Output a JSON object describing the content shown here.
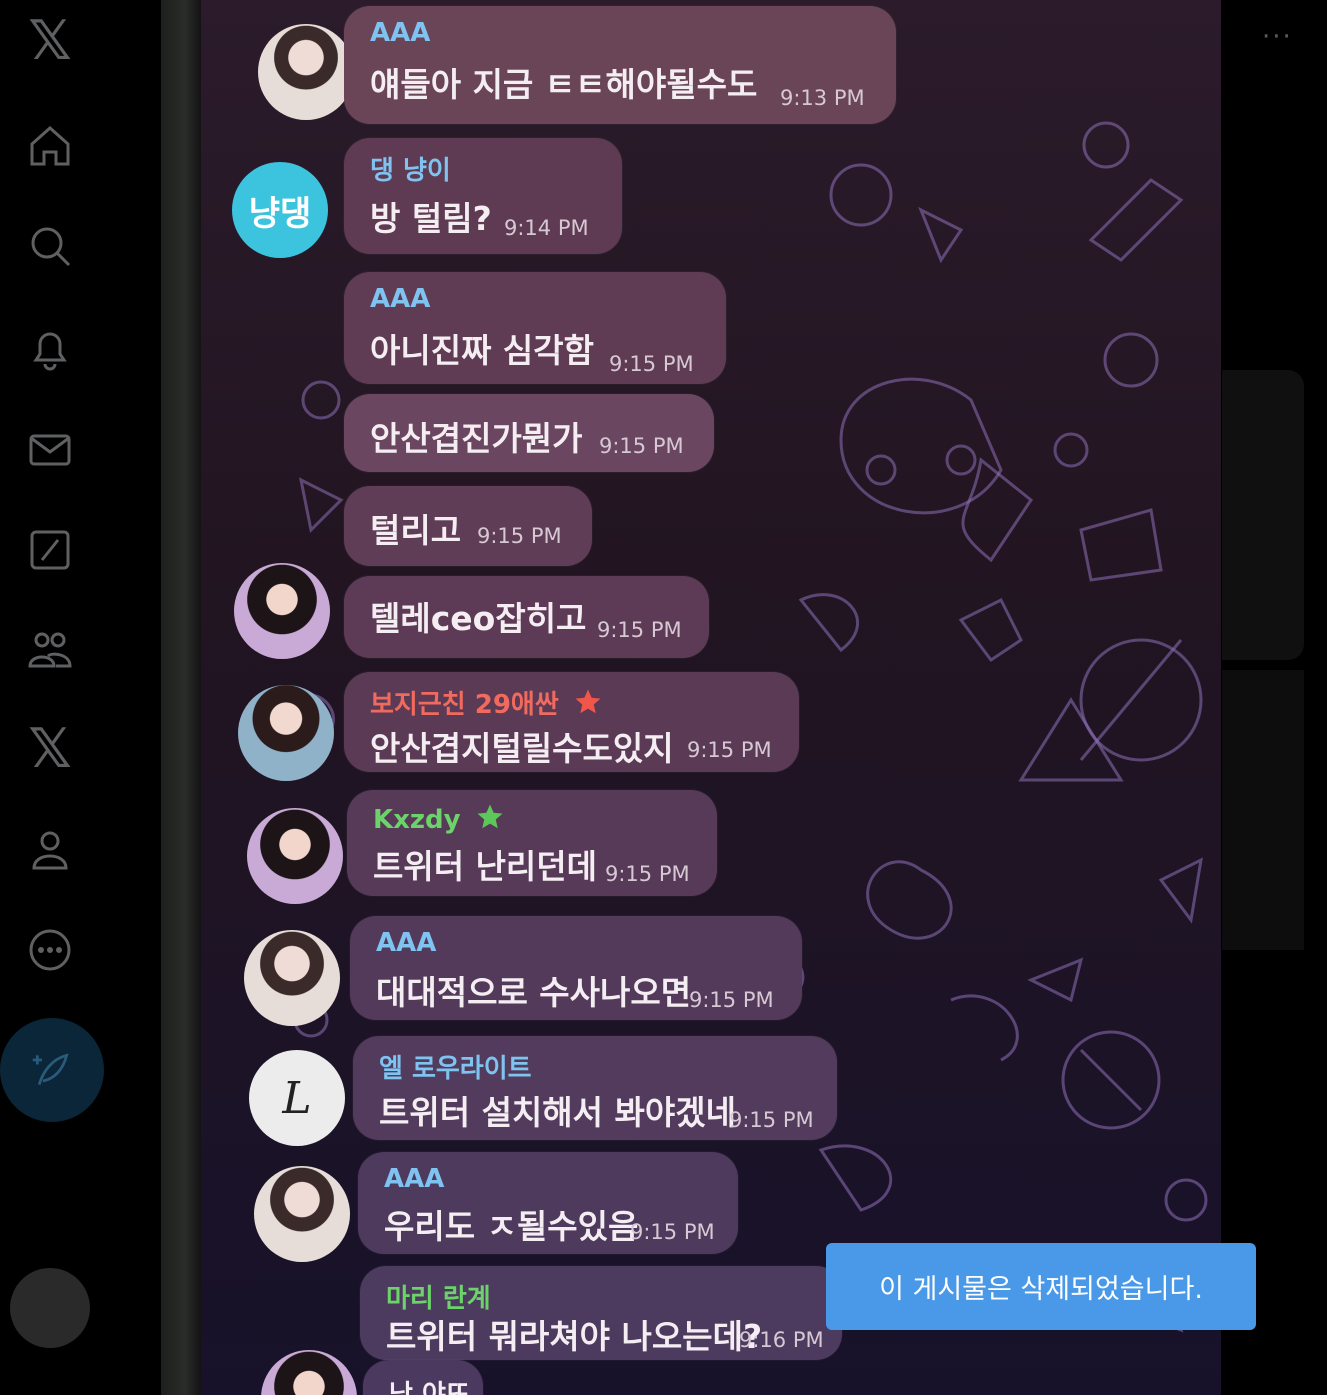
{
  "x_sidebar": {
    "items": [
      {
        "icon": "x-logo-icon",
        "label": "𝕏"
      },
      {
        "icon": "home-icon"
      },
      {
        "icon": "search-icon"
      },
      {
        "icon": "notifications-bell-icon"
      },
      {
        "icon": "messages-envelope-icon"
      },
      {
        "icon": "grok-slash-icon"
      },
      {
        "icon": "communities-people-icon"
      },
      {
        "icon": "premium-x-icon",
        "label": "𝕏"
      },
      {
        "icon": "profile-person-icon"
      },
      {
        "icon": "more-circle-icon"
      }
    ],
    "post_button_icon": "compose-feather-icon"
  },
  "right_more": "···",
  "chat": {
    "messages": [
      {
        "sender": "AAA",
        "sender_color": "#7fc3f0",
        "text": "얘들아 지금 ㅌㅌ해야될수도",
        "time": "9:13 PM"
      },
      {
        "sender": "댕 냥이",
        "sender_color": "#7fc3f0",
        "avatar_text": "냥댕",
        "text": "방 털림?",
        "time": "9:14 PM"
      },
      {
        "sender": "AAA",
        "sender_color": "#7fc3f0",
        "text": "아니진짜 심각함",
        "time": "9:15 PM"
      },
      {
        "text": "안산겹진가뭔가",
        "time": "9:15 PM"
      },
      {
        "text": "털리고",
        "time": "9:15 PM"
      },
      {
        "text": "텔레ceo잡히고",
        "time": "9:15 PM"
      },
      {
        "sender": "보지근친 29애싼",
        "sender_color": "#f06a5e",
        "text": "안산겹지털릴수도있지",
        "time": "9:15 PM"
      },
      {
        "sender": "Kxzdy",
        "sender_color": "#6cd36a",
        "text": "트위터 난리던데",
        "time": "9:15 PM"
      },
      {
        "sender": "AAA",
        "sender_color": "#7fc3f0",
        "text": "대대적으로 수사나오면",
        "time": "9:15 PM"
      },
      {
        "sender": "엘 로우라이트",
        "sender_color": "#7fc3f0",
        "avatar_text": "L",
        "text": "트위터 설치해서 봐야겠네",
        "time": "9:15 PM"
      },
      {
        "sender": "AAA",
        "sender_color": "#7fc3f0",
        "text": "우리도 ㅈ될수있음",
        "time": "9:15 PM"
      },
      {
        "sender": "마리 란계",
        "sender_color": "#6cd36a",
        "text": "트위터 뭐라쳐야 나오는데?",
        "time": "9:16 PM"
      },
      {
        "sender": "낫 야뜨"
      }
    ]
  },
  "toast": {
    "text": "이 게시물은 삭제되었습니다."
  }
}
